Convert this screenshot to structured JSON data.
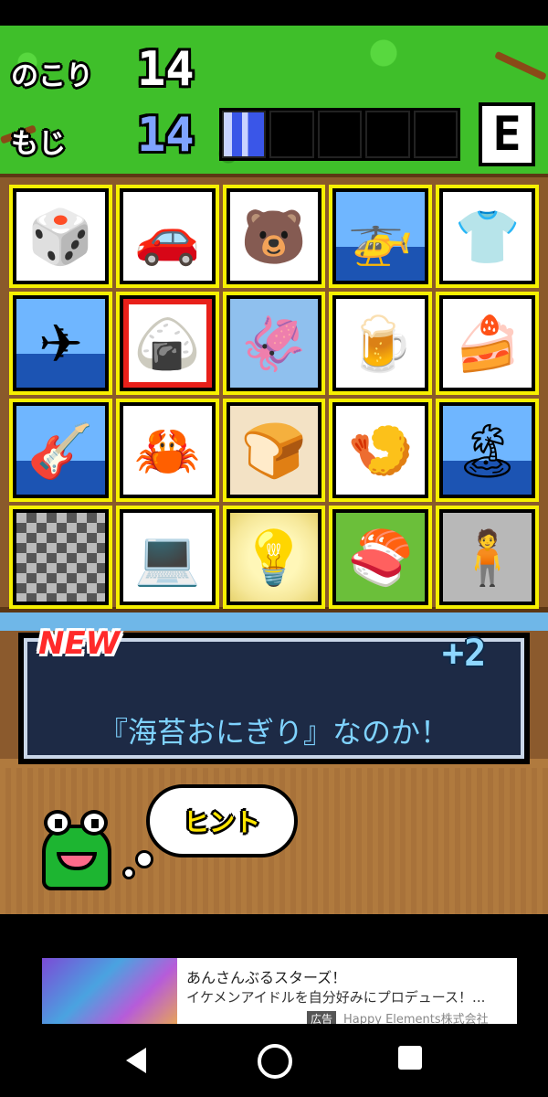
{
  "hud": {
    "remaining_label": "のこり",
    "remaining_value": "14",
    "letters_label": "もじ",
    "letters_value": "14",
    "gauge_filled": 1,
    "gauge_total": 5,
    "rank": "E"
  },
  "tiles": [
    {
      "name": "dice",
      "icon": "🎲",
      "bg": "white"
    },
    {
      "name": "car",
      "icon": "🚗",
      "bg": "white"
    },
    {
      "name": "bear",
      "icon": "🐻",
      "bg": "white"
    },
    {
      "name": "helicopter",
      "icon": "🚁",
      "bg": "sky"
    },
    {
      "name": "t-shirt",
      "icon": "👕",
      "bg": "white"
    },
    {
      "name": "airplane",
      "icon": "✈",
      "bg": "sky"
    },
    {
      "name": "onigiri",
      "icon": "🍙",
      "bg": "white",
      "selected": true
    },
    {
      "name": "squid",
      "icon": "🦑",
      "bg": "blue"
    },
    {
      "name": "beer",
      "icon": "🍺",
      "bg": "white"
    },
    {
      "name": "cake",
      "icon": "🍰",
      "bg": "white"
    },
    {
      "name": "guitar",
      "icon": "🎸",
      "bg": "sky"
    },
    {
      "name": "crab",
      "icon": "🦀",
      "bg": "white"
    },
    {
      "name": "bread",
      "icon": "🍞",
      "bg": "beige"
    },
    {
      "name": "shrimp",
      "icon": "🍤",
      "bg": "white"
    },
    {
      "name": "island",
      "icon": "🏝",
      "bg": "sky"
    },
    {
      "name": "hidden",
      "icon": "",
      "bg": "checker"
    },
    {
      "name": "computer",
      "icon": "💻",
      "bg": "white"
    },
    {
      "name": "light-bulb",
      "icon": "💡",
      "bg": "glow"
    },
    {
      "name": "sushi",
      "icon": "🍣",
      "bg": "green"
    },
    {
      "name": "person",
      "icon": "🧍",
      "bg": "grey"
    }
  ],
  "message": {
    "new_label": "NEW",
    "plus": "+2",
    "text": "『海苔おにぎり』なのか！"
  },
  "hint": {
    "label": "ヒント"
  },
  "ad": {
    "title": "あんさんぶるスターズ！",
    "description": "イケメンアイドルを自分好みにプロデュース！...",
    "badge": "広告",
    "advertiser": "Happy Elements株式会社"
  },
  "colors": {
    "tile_border": "#f6f000",
    "selected_border": "#e8201a",
    "grass": "#3fbf2a",
    "board": "#8a5a2b"
  }
}
